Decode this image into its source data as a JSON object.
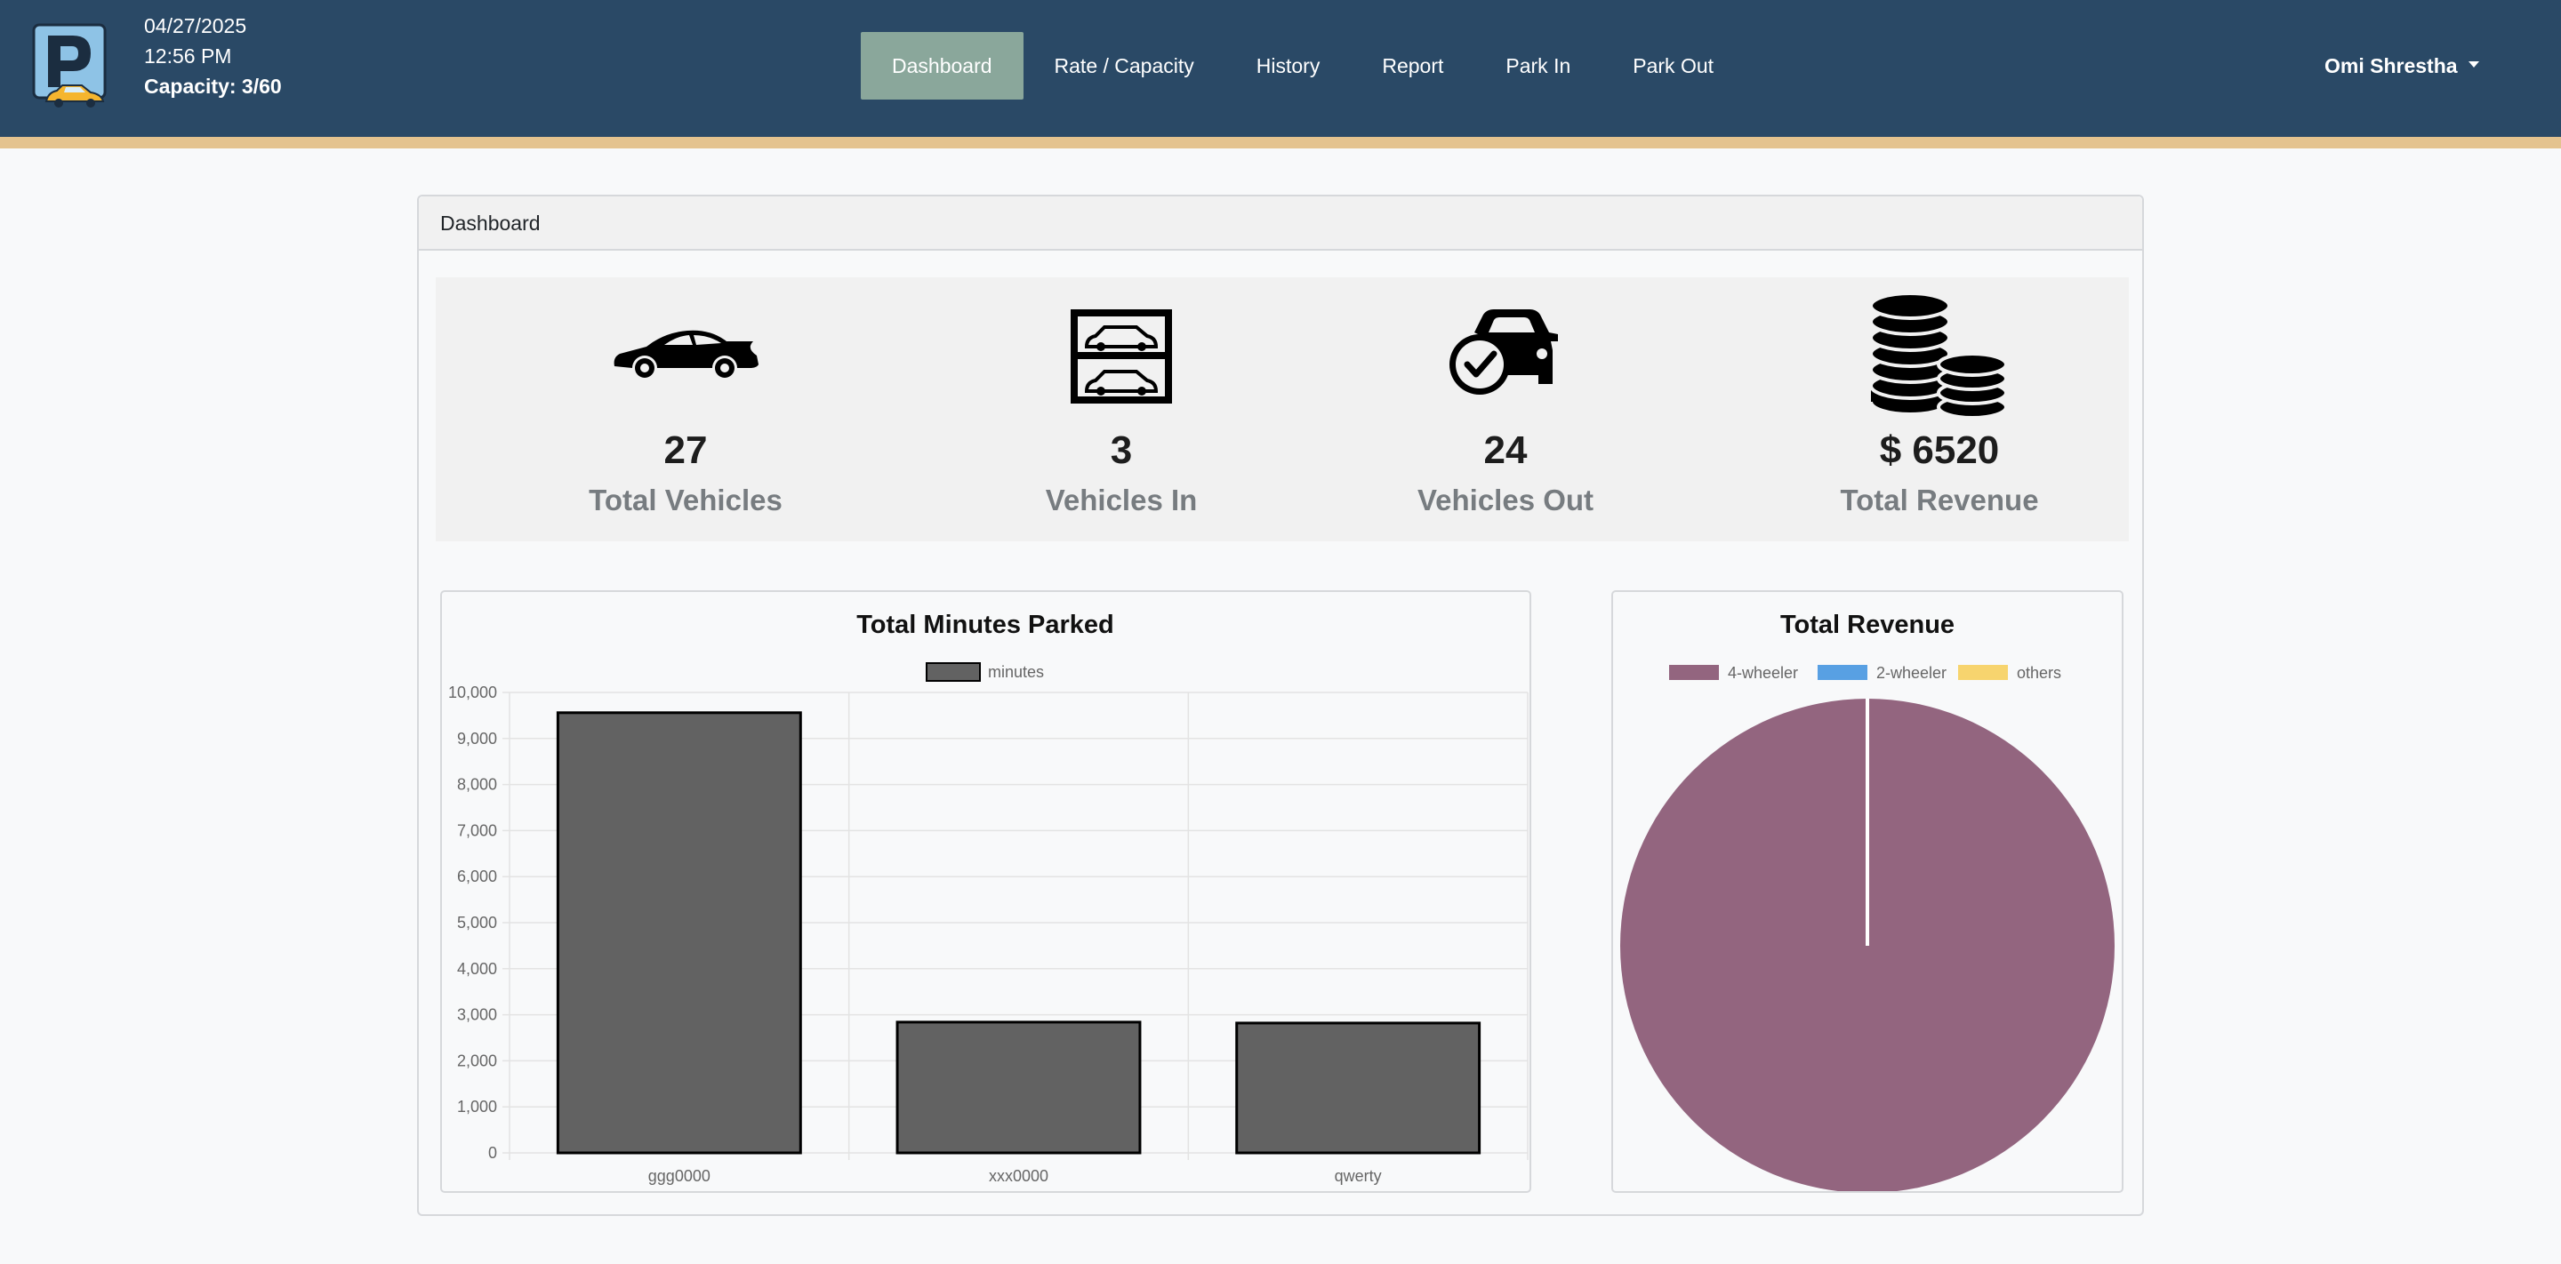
{
  "header": {
    "date": "04/27/2025",
    "time": "12:56 PM",
    "capacity": "Capacity: 3/60",
    "nav": [
      "Dashboard",
      "Rate / Capacity",
      "History",
      "Report",
      "Park In",
      "Park Out"
    ],
    "user": "Omi Shrestha"
  },
  "card": {
    "title": "Dashboard"
  },
  "stats": [
    {
      "icon": "car-icon",
      "value": "27",
      "label": "Total Vehicles"
    },
    {
      "icon": "parking-garage-icon",
      "value": "3",
      "label": "Vehicles In"
    },
    {
      "icon": "car-checked-icon",
      "value": "24",
      "label": "Vehicles Out"
    },
    {
      "icon": "coins-icon",
      "value": "$ 6520",
      "label": "Total Revenue"
    }
  ],
  "colors": {
    "navbar": "#2a4966",
    "stripe": "#e4c38f",
    "active_nav": "#8aa79b",
    "bar": "#626262",
    "pie_4wheeler": "#93657f",
    "pie_2wheeler": "#58a0e3",
    "pie_others": "#f7d46e"
  },
  "chart_data": [
    {
      "type": "bar",
      "title": "Total Minutes Parked",
      "categories": [
        "ggg0000",
        "xxx0000",
        "qwerty"
      ],
      "series": [
        {
          "name": "minutes",
          "values": [
            9560,
            2840,
            2820
          ]
        }
      ],
      "ylim": [
        0,
        10000
      ],
      "yticks": [
        "0",
        "1,000",
        "2,000",
        "3,000",
        "4,000",
        "5,000",
        "6,000",
        "7,000",
        "8,000",
        "9,000",
        "10,000"
      ],
      "grid": true,
      "legend": "top"
    },
    {
      "type": "pie",
      "title": "Total Revenue",
      "labels": [
        "4-wheeler",
        "2-wheeler",
        "others"
      ],
      "values": [
        6520,
        0,
        0
      ],
      "legend": "top"
    }
  ]
}
